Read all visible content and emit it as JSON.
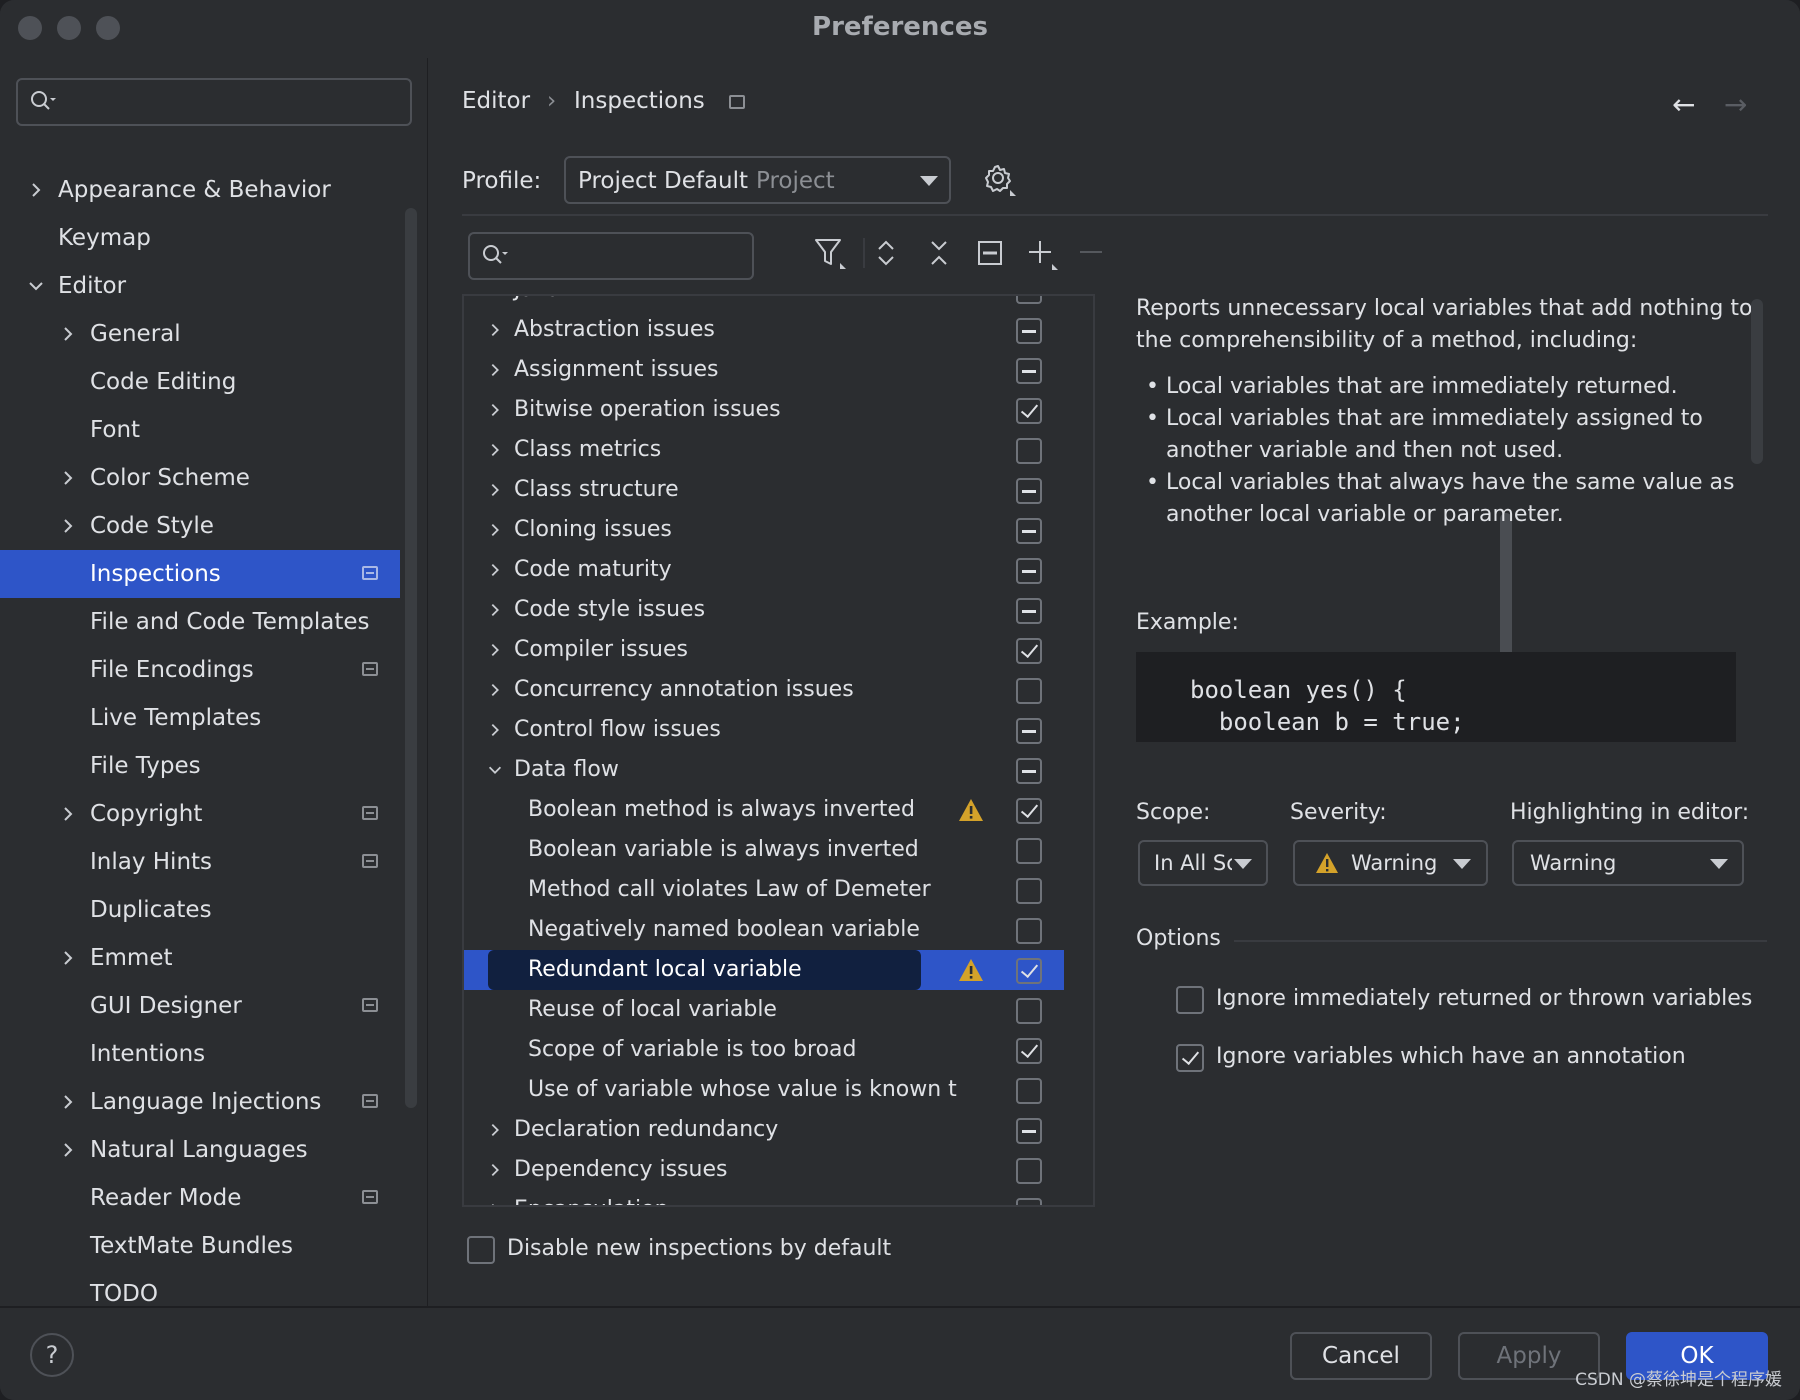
{
  "window": {
    "title": "Preferences"
  },
  "sidebar": {
    "search": {
      "placeholder": ""
    },
    "items": [
      {
        "label": "Appearance & Behavior",
        "indent": 0,
        "chevron": "right",
        "project": false,
        "selected": false
      },
      {
        "label": "Keymap",
        "indent": 0,
        "chevron": "none",
        "project": false,
        "selected": false
      },
      {
        "label": "Editor",
        "indent": 0,
        "chevron": "down",
        "project": false,
        "selected": false
      },
      {
        "label": "General",
        "indent": 1,
        "chevron": "right",
        "project": false,
        "selected": false
      },
      {
        "label": "Code Editing",
        "indent": 1,
        "chevron": "none",
        "project": false,
        "selected": false
      },
      {
        "label": "Font",
        "indent": 1,
        "chevron": "none",
        "project": false,
        "selected": false
      },
      {
        "label": "Color Scheme",
        "indent": 1,
        "chevron": "right",
        "project": false,
        "selected": false
      },
      {
        "label": "Code Style",
        "indent": 1,
        "chevron": "right",
        "project": false,
        "selected": false
      },
      {
        "label": "Inspections",
        "indent": 1,
        "chevron": "none",
        "project": true,
        "selected": true
      },
      {
        "label": "File and Code Templates",
        "indent": 1,
        "chevron": "none",
        "project": false,
        "selected": false
      },
      {
        "label": "File Encodings",
        "indent": 1,
        "chevron": "none",
        "project": true,
        "selected": false
      },
      {
        "label": "Live Templates",
        "indent": 1,
        "chevron": "none",
        "project": false,
        "selected": false
      },
      {
        "label": "File Types",
        "indent": 1,
        "chevron": "none",
        "project": false,
        "selected": false
      },
      {
        "label": "Copyright",
        "indent": 1,
        "chevron": "right",
        "project": true,
        "selected": false
      },
      {
        "label": "Inlay Hints",
        "indent": 1,
        "chevron": "none",
        "project": true,
        "selected": false
      },
      {
        "label": "Duplicates",
        "indent": 1,
        "chevron": "none",
        "project": false,
        "selected": false
      },
      {
        "label": "Emmet",
        "indent": 1,
        "chevron": "right",
        "project": false,
        "selected": false
      },
      {
        "label": "GUI Designer",
        "indent": 1,
        "chevron": "none",
        "project": true,
        "selected": false
      },
      {
        "label": "Intentions",
        "indent": 1,
        "chevron": "none",
        "project": false,
        "selected": false
      },
      {
        "label": "Language Injections",
        "indent": 1,
        "chevron": "right",
        "project": true,
        "selected": false
      },
      {
        "label": "Natural Languages",
        "indent": 1,
        "chevron": "right",
        "project": false,
        "selected": false
      },
      {
        "label": "Reader Mode",
        "indent": 1,
        "chevron": "none",
        "project": true,
        "selected": false
      },
      {
        "label": "TextMate Bundles",
        "indent": 1,
        "chevron": "none",
        "project": false,
        "selected": false
      },
      {
        "label": "TODO",
        "indent": 1,
        "chevron": "none",
        "project": false,
        "selected": false
      }
    ]
  },
  "breadcrumb": {
    "editor": "Editor",
    "separator": "›",
    "inspections": "Inspections"
  },
  "profile": {
    "label": "Profile:",
    "value": "Project Default",
    "scope": "Project"
  },
  "inspections": [
    {
      "label": "Java",
      "indent": 0,
      "chevron": "down",
      "state": "mixed",
      "warning": false,
      "selected": false
    },
    {
      "label": "Abstraction issues",
      "indent": 0,
      "chevron": "right",
      "state": "mixed",
      "warning": false,
      "selected": false
    },
    {
      "label": "Assignment issues",
      "indent": 0,
      "chevron": "right",
      "state": "mixed",
      "warning": false,
      "selected": false
    },
    {
      "label": "Bitwise operation issues",
      "indent": 0,
      "chevron": "right",
      "state": "checked",
      "warning": false,
      "selected": false
    },
    {
      "label": "Class metrics",
      "indent": 0,
      "chevron": "right",
      "state": "unchecked",
      "warning": false,
      "selected": false
    },
    {
      "label": "Class structure",
      "indent": 0,
      "chevron": "right",
      "state": "mixed",
      "warning": false,
      "selected": false
    },
    {
      "label": "Cloning issues",
      "indent": 0,
      "chevron": "right",
      "state": "mixed",
      "warning": false,
      "selected": false
    },
    {
      "label": "Code maturity",
      "indent": 0,
      "chevron": "right",
      "state": "mixed",
      "warning": false,
      "selected": false
    },
    {
      "label": "Code style issues",
      "indent": 0,
      "chevron": "right",
      "state": "mixed",
      "warning": false,
      "selected": false
    },
    {
      "label": "Compiler issues",
      "indent": 0,
      "chevron": "right",
      "state": "checked",
      "warning": false,
      "selected": false
    },
    {
      "label": "Concurrency annotation issues",
      "indent": 0,
      "chevron": "right",
      "state": "unchecked",
      "warning": false,
      "selected": false
    },
    {
      "label": "Control flow issues",
      "indent": 0,
      "chevron": "right",
      "state": "mixed",
      "warning": false,
      "selected": false
    },
    {
      "label": "Data flow",
      "indent": 0,
      "chevron": "down",
      "state": "mixed",
      "warning": false,
      "selected": false
    },
    {
      "label": "Boolean method is always inverted",
      "indent": 1,
      "chevron": "none",
      "state": "checked",
      "warning": true,
      "selected": false
    },
    {
      "label": "Boolean variable is always inverted",
      "indent": 1,
      "chevron": "none",
      "state": "unchecked",
      "warning": false,
      "selected": false
    },
    {
      "label": "Method call violates Law of Demeter",
      "indent": 1,
      "chevron": "none",
      "state": "unchecked",
      "warning": false,
      "selected": false
    },
    {
      "label": "Negatively named boolean variable",
      "indent": 1,
      "chevron": "none",
      "state": "unchecked",
      "warning": false,
      "selected": false
    },
    {
      "label": "Redundant local variable",
      "indent": 1,
      "chevron": "none",
      "state": "checked",
      "warning": true,
      "selected": true
    },
    {
      "label": "Reuse of local variable",
      "indent": 1,
      "chevron": "none",
      "state": "unchecked",
      "warning": false,
      "selected": false
    },
    {
      "label": "Scope of variable is too broad",
      "indent": 1,
      "chevron": "none",
      "state": "checked",
      "warning": false,
      "selected": false
    },
    {
      "label": "Use of variable whose value is known t",
      "indent": 1,
      "chevron": "none",
      "state": "unchecked",
      "warning": false,
      "selected": false
    },
    {
      "label": "Declaration redundancy",
      "indent": 0,
      "chevron": "right",
      "state": "mixed",
      "warning": false,
      "selected": false
    },
    {
      "label": "Dependency issues",
      "indent": 0,
      "chevron": "right",
      "state": "unchecked",
      "warning": false,
      "selected": false
    },
    {
      "label": "Encapsulation",
      "indent": 0,
      "chevron": "right",
      "state": "unchecked",
      "warning": false,
      "selected": false
    }
  ],
  "description": {
    "intro": "Reports unnecessary local variables that add nothing to the comprehensibility of a method, including:",
    "bullets": [
      "Local variables that are immediately returned.",
      "Local variables that are immediately assigned to another variable and then not used.",
      "Local variables that always have the same value as another local variable or parameter."
    ],
    "example_label": "Example:",
    "code": "boolean yes() {\n  boolean b = true;"
  },
  "scope": {
    "label": "Scope:",
    "value": "In All Scopes"
  },
  "severity": {
    "label": "Severity:",
    "value": "Warning"
  },
  "highlighting": {
    "label": "Highlighting in editor:",
    "value": "Warning"
  },
  "options": {
    "label": "Options",
    "items": [
      {
        "label": "Ignore immediately returned or thrown variables",
        "checked": false
      },
      {
        "label": "Ignore variables which have an annotation",
        "checked": true
      }
    ]
  },
  "disable_new": {
    "label": "Disable new inspections by default",
    "checked": false
  },
  "footer": {
    "help": "?",
    "cancel": "Cancel",
    "apply": "Apply",
    "ok": "OK",
    "watermark": "CSDN @蔡徐坤是个程序媛"
  },
  "colors": {
    "accent": "#2e55c8",
    "selection_dark": "#11203f",
    "warning": "#d4a22a",
    "background": "#2b2d30"
  }
}
